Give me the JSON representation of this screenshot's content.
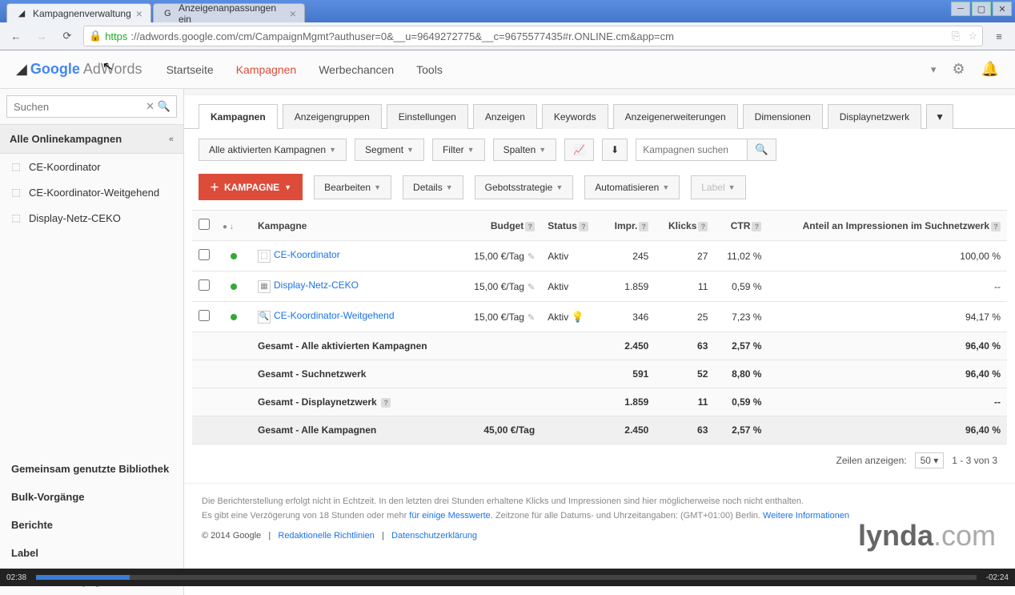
{
  "browser": {
    "tabs": [
      {
        "title": "Kampagnenverwaltung",
        "active": true
      },
      {
        "title": "Anzeigenanpassungen ein",
        "active": false
      }
    ],
    "url_https": "https",
    "url_rest": "://adwords.google.com/cm/CampaignMgmt?authuser=0&__u=9649272775&__c=9675577435#r.ONLINE.cm&app=cm"
  },
  "logo": {
    "google": "Google",
    "adwords": "AdWords"
  },
  "topnav": [
    "Startseite",
    "Kampagnen",
    "Werbechancen",
    "Tools"
  ],
  "topnav_active": 1,
  "sidebar": {
    "search_placeholder": "Suchen",
    "header": "Alle Onlinekampagnen",
    "items": [
      {
        "label": "CE-Koordinator"
      },
      {
        "label": "CE-Koordinator-Weitgehend"
      },
      {
        "label": "Display-Netz-CEKO"
      }
    ],
    "links": [
      {
        "label": "Gemeinsam genutzte Bibliothek",
        "bold": true
      },
      {
        "label": "Bulk-Vorgänge",
        "bold": true
      },
      {
        "label": "Berichte",
        "bold": true
      },
      {
        "label": "Label",
        "bold": true
      },
      {
        "label": "Alle Videokampagnen",
        "bold": true
      }
    ]
  },
  "main_tabs": [
    "Kampagnen",
    "Anzeigengruppen",
    "Einstellungen",
    "Anzeigen",
    "Keywords",
    "Anzeigenerweiterungen",
    "Dimensionen",
    "Displaynetzwerk"
  ],
  "main_tabs_active": 0,
  "toolbar": {
    "filter_campaigns": "Alle aktivierten Kampagnen",
    "segment": "Segment",
    "filter": "Filter",
    "columns": "Spalten",
    "search_placeholder": "Kampagnen suchen"
  },
  "actions": {
    "add": "KAMPAGNE",
    "edit": "Bearbeiten",
    "details": "Details",
    "bidding": "Gebotsstrategie",
    "automate": "Automatisieren",
    "label": "Label"
  },
  "table": {
    "headers": {
      "campaign": "Kampagne",
      "budget": "Budget",
      "status": "Status",
      "impr": "Impr.",
      "klicks": "Klicks",
      "ctr": "CTR",
      "share": "Anteil an Impressionen im Suchnetzwerk"
    },
    "rows": [
      {
        "name": "CE-Koordinator",
        "budget": "15,00 €/Tag",
        "status": "Aktiv",
        "impr": "245",
        "klicks": "27",
        "ctr": "11,02 %",
        "share": "100,00 %",
        "bulb": false,
        "icon": "⬚"
      },
      {
        "name": "Display-Netz-CEKO",
        "budget": "15,00 €/Tag",
        "status": "Aktiv",
        "impr": "1.859",
        "klicks": "11",
        "ctr": "0,59 %",
        "share": "--",
        "bulb": false,
        "icon": "▦"
      },
      {
        "name": "CE-Koordinator-Weitgehend",
        "budget": "15,00 €/Tag",
        "status": "Aktiv",
        "impr": "346",
        "klicks": "25",
        "ctr": "7,23 %",
        "share": "94,17 %",
        "bulb": true,
        "icon": "🔍"
      }
    ],
    "summaries": [
      {
        "label": "Gesamt - Alle aktivierten Kampagnen",
        "budget": "",
        "impr": "2.450",
        "klicks": "63",
        "ctr": "2,57 %",
        "share": "96,40 %"
      },
      {
        "label": "Gesamt - Suchnetzwerk",
        "budget": "",
        "impr": "591",
        "klicks": "52",
        "ctr": "8,80 %",
        "share": "96,40 %"
      },
      {
        "label": "Gesamt - Displaynetzwerk",
        "budget": "",
        "impr": "1.859",
        "klicks": "11",
        "ctr": "0,59 %",
        "share": "--",
        "help": true
      }
    ],
    "grand": {
      "label": "Gesamt - Alle Kampagnen",
      "budget": "45,00 €/Tag",
      "impr": "2.450",
      "klicks": "63",
      "ctr": "2,57 %",
      "share": "96,40 %"
    }
  },
  "pager": {
    "label": "Zeilen anzeigen:",
    "size": "50",
    "range": "1 - 3 von 3"
  },
  "footer": {
    "line1a": "Die Berichterstellung erfolgt nicht in Echtzeit. In den letzten drei Stunden erhaltene Klicks und Impressionen sind hier möglicherweise noch nicht enthalten.",
    "line2a": "Es gibt eine Verzögerung von 18 Stunden oder mehr ",
    "line2link": "für einige Messwerte.",
    "line2b": " Zeitzone für alle Datums- und Uhrzeitangaben: (GMT+01:00) Berlin. ",
    "line2more": "Weitere Informationen",
    "copyright": "© 2014 Google",
    "guidelines": "Redaktionelle Richtlinien",
    "privacy": "Datenschutzerklärung"
  },
  "watermark": {
    "a": "lynda",
    "b": ".com"
  },
  "video": {
    "cur": "02:38",
    "total": "-02:24"
  }
}
